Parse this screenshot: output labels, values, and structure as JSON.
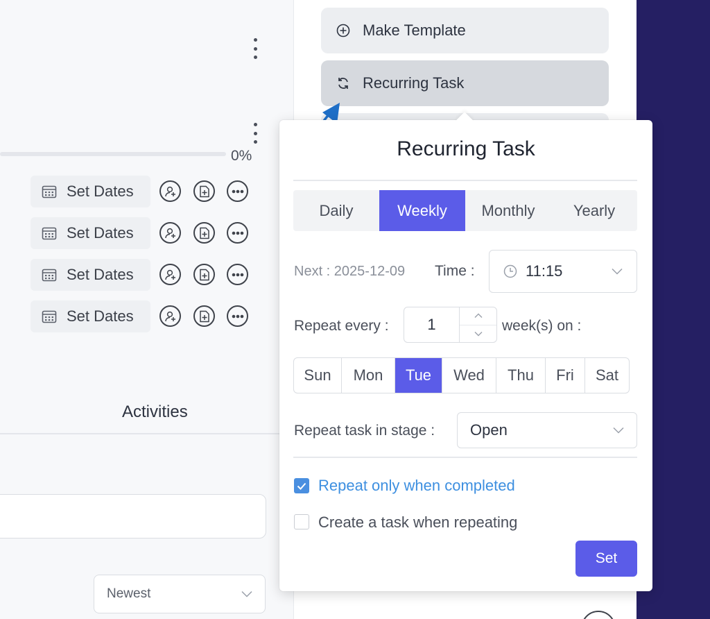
{
  "progress": {
    "percent_label": "0%",
    "value": 0
  },
  "task_rows": [
    {
      "set_dates_label": "Set Dates"
    },
    {
      "set_dates_label": "Set Dates"
    },
    {
      "set_dates_label": "Set Dates"
    },
    {
      "set_dates_label": "Set Dates"
    }
  ],
  "activities": {
    "title": "Activities",
    "sort": {
      "selected": "Newest"
    }
  },
  "side_menu": {
    "make_template": "Make Template",
    "recurring_task": "Recurring Task"
  },
  "popover": {
    "title": "Recurring Task",
    "frequency_tabs": [
      "Daily",
      "Weekly",
      "Monthly",
      "Yearly"
    ],
    "active_frequency": "Weekly",
    "next_label": "Next : 2025-12-09",
    "time_label": "Time :",
    "time_value": "11:15",
    "repeat_every_label": "Repeat every :",
    "repeat_every_value": "1",
    "weeks_on_label": "week(s) on :",
    "days": [
      "Sun",
      "Mon",
      "Tue",
      "Wed",
      "Thu",
      "Fri",
      "Sat"
    ],
    "active_day": "Tue",
    "stage_label": "Repeat task in stage :",
    "stage_value": "Open",
    "repeat_only_completed_label": "Repeat only when completed",
    "repeat_only_completed_checked": true,
    "create_task_label": "Create a task when repeating",
    "create_task_checked": false,
    "set_button": "Set"
  },
  "colors": {
    "accent": "#5b5ce8",
    "checkbox_blue": "#4a8fe0",
    "link_blue": "#3d8fe0",
    "sidebar_navy": "#251f63",
    "arrow_blue": "#1f6fc7"
  }
}
